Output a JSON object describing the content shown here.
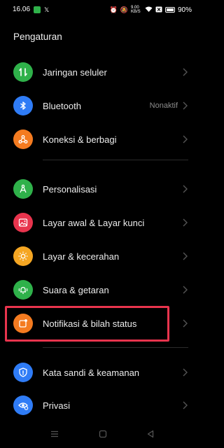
{
  "status_bar": {
    "time": "16.06",
    "speed": "9.00 KB/S",
    "battery": "90%"
  },
  "header": {
    "title": "Pengaturan"
  },
  "items": [
    {
      "label": "Jaringan seluler",
      "value": "",
      "icon": "cellular-data-icon",
      "color": "#2fb14a"
    },
    {
      "label": "Bluetooth",
      "value": "Nonaktif",
      "icon": "bluetooth-icon",
      "color": "#2f7cf6"
    },
    {
      "label": "Koneksi & berbagi",
      "value": "",
      "icon": "connection-share-icon",
      "color": "#f47b20"
    },
    {
      "label": "Personalisasi",
      "value": "",
      "icon": "personalization-icon",
      "color": "#2fb14a"
    },
    {
      "label": "Layar awal & Layar kunci",
      "value": "",
      "icon": "home-lock-screen-icon",
      "color": "#e8344d"
    },
    {
      "label": "Layar & kecerahan",
      "value": "",
      "icon": "brightness-icon",
      "color": "#f5a623"
    },
    {
      "label": "Suara & getaran",
      "value": "",
      "icon": "sound-vibration-icon",
      "color": "#2fb14a"
    },
    {
      "label": "Notifikasi & bilah status",
      "value": "",
      "icon": "notification-icon",
      "color": "#f47b20"
    },
    {
      "label": "Kata sandi & keamanan",
      "value": "",
      "icon": "security-shield-icon",
      "color": "#2f7cf6"
    },
    {
      "label": "Privasi",
      "value": "",
      "icon": "privacy-icon",
      "color": "#2f7cf6"
    }
  ],
  "colors": {
    "highlight": "#e8344d",
    "background": "#000000"
  }
}
